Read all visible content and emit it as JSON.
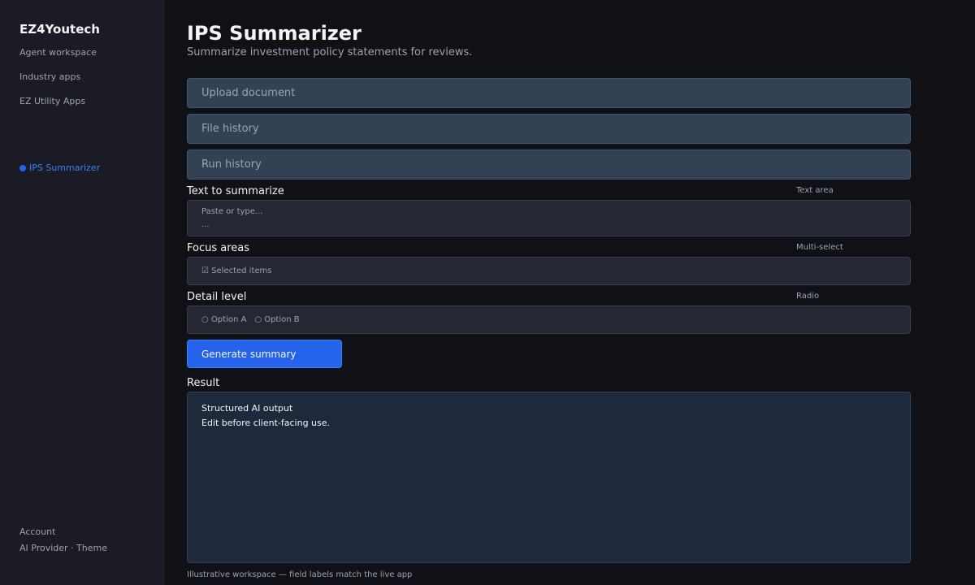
{
  "sidebar": {
    "brand": "EZ4Youtech",
    "items": [
      {
        "label": "Agent workspace"
      },
      {
        "label": "Industry apps"
      },
      {
        "label": "EZ Utility Apps"
      }
    ],
    "active_item": "IPS Summarizer",
    "footer": {
      "account": "Account",
      "provider_theme": "AI Provider · Theme"
    }
  },
  "page": {
    "title": "IPS Summarizer",
    "subtitle": "Summarize investment policy statements for reviews."
  },
  "sections": {
    "upload": "Upload document",
    "file_history": "File history",
    "run_history": "Run history"
  },
  "fields": {
    "text": {
      "label": "Text to summarize",
      "type": "Text area",
      "placeholder": "Paste or type...",
      "ellipsis": "..."
    },
    "focus": {
      "label": "Focus areas",
      "type": "Multi-select",
      "value": "☑ Selected items"
    },
    "detail": {
      "label": "Detail level",
      "type": "Radio",
      "options": [
        "○ Option A",
        "○ Option B"
      ]
    }
  },
  "action": {
    "generate_label": "Generate summary"
  },
  "result": {
    "label": "Result",
    "lines": [
      "Structured AI output",
      "Edit before client-facing use."
    ]
  },
  "footer_note": "Illustrative workspace — field labels match the live app",
  "colors": {
    "accent": "#2563eb",
    "background": "#0f1117",
    "sidebar": "#1a1b25"
  }
}
